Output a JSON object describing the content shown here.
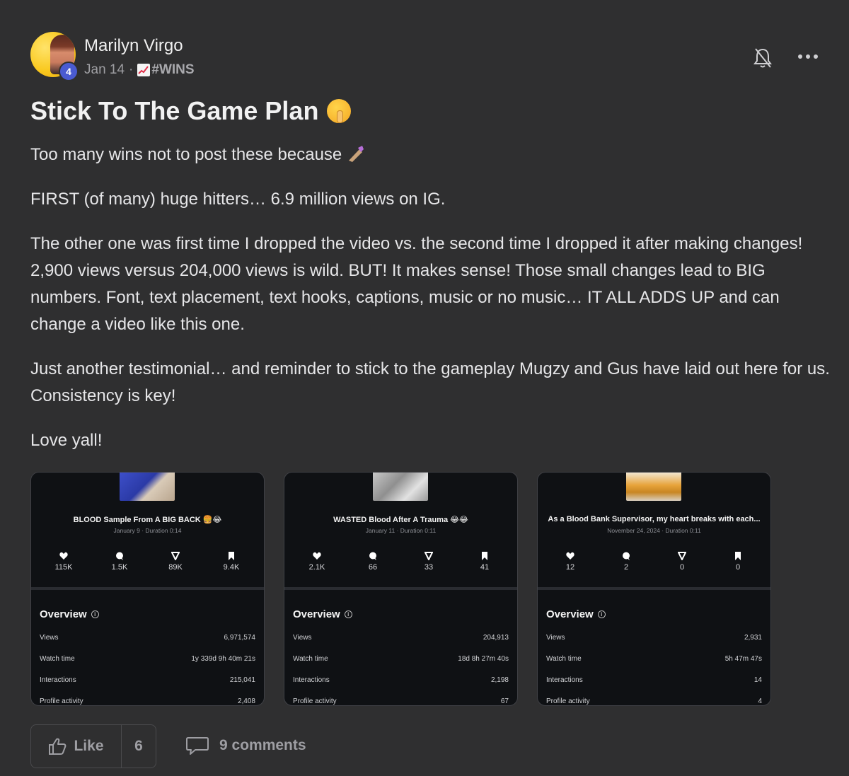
{
  "post": {
    "author": "Marilyn Virgo",
    "level": "4",
    "date": "Jan 14",
    "separator": "·",
    "category": "#WINS",
    "title": "Stick To The Game Plan",
    "paragraphs": [
      "Too many wins not to post these because",
      "FIRST (of many) huge hitters… 6.9 million views on IG.",
      "The other one was first time I dropped the video vs. the second time I dropped it after making changes! 2,900 views versus 204,000 views is wild. BUT! It makes sense! Those small changes lead to BIG numbers. Font, text placement, text hooks, captions, music or no music… IT ALL ADDS UP and can change a video like this one.",
      "Just another testimonial… and reminder to stick to the gameplay Mugzy and Gus have laid out here for us. Consistency is key!",
      "Love yall!"
    ]
  },
  "cards": [
    {
      "title": "BLOOD Sample From A BIG BACK 🍔😂",
      "subtitle": "January 9 · Duration 0:14",
      "stats": {
        "likes": "115K",
        "comments": "1.5K",
        "shares": "89K",
        "saves": "9.4K"
      },
      "overview_title": "Overview",
      "rows": [
        {
          "label": "Views",
          "value": "6,971,574"
        },
        {
          "label": "Watch time",
          "value": "1y 339d 9h 40m 21s"
        },
        {
          "label": "Interactions",
          "value": "215,041"
        },
        {
          "label": "Profile activity",
          "value": "2,408"
        }
      ]
    },
    {
      "title": "WASTED Blood After A Trauma 😂😂",
      "subtitle": "January 11 · Duration 0:11",
      "stats": {
        "likes": "2.1K",
        "comments": "66",
        "shares": "33",
        "saves": "41"
      },
      "overview_title": "Overview",
      "rows": [
        {
          "label": "Views",
          "value": "204,913"
        },
        {
          "label": "Watch time",
          "value": "18d 8h 27m 40s"
        },
        {
          "label": "Interactions",
          "value": "2,198"
        },
        {
          "label": "Profile activity",
          "value": "67"
        }
      ]
    },
    {
      "title": "As a Blood Bank Supervisor, my heart breaks with each...",
      "subtitle": "November 24, 2024 · Duration 0:11",
      "stats": {
        "likes": "12",
        "comments": "2",
        "shares": "0",
        "saves": "0"
      },
      "overview_title": "Overview",
      "rows": [
        {
          "label": "Views",
          "value": "2,931"
        },
        {
          "label": "Watch time",
          "value": "5h 47m 47s"
        },
        {
          "label": "Interactions",
          "value": "14"
        },
        {
          "label": "Profile activity",
          "value": "4"
        }
      ]
    }
  ],
  "footer": {
    "like_label": "Like",
    "like_count": "6",
    "comments_label": "9 comments"
  },
  "icons": {
    "bell": "bell-muted-icon",
    "more": "more-horizontal-icon",
    "like": "thumbs-up-icon",
    "comment": "comment-bubble-icon"
  },
  "colors": {
    "background": "#2f2f30",
    "card_background": "#0f1114",
    "level_badge": "#4a5bd1"
  }
}
